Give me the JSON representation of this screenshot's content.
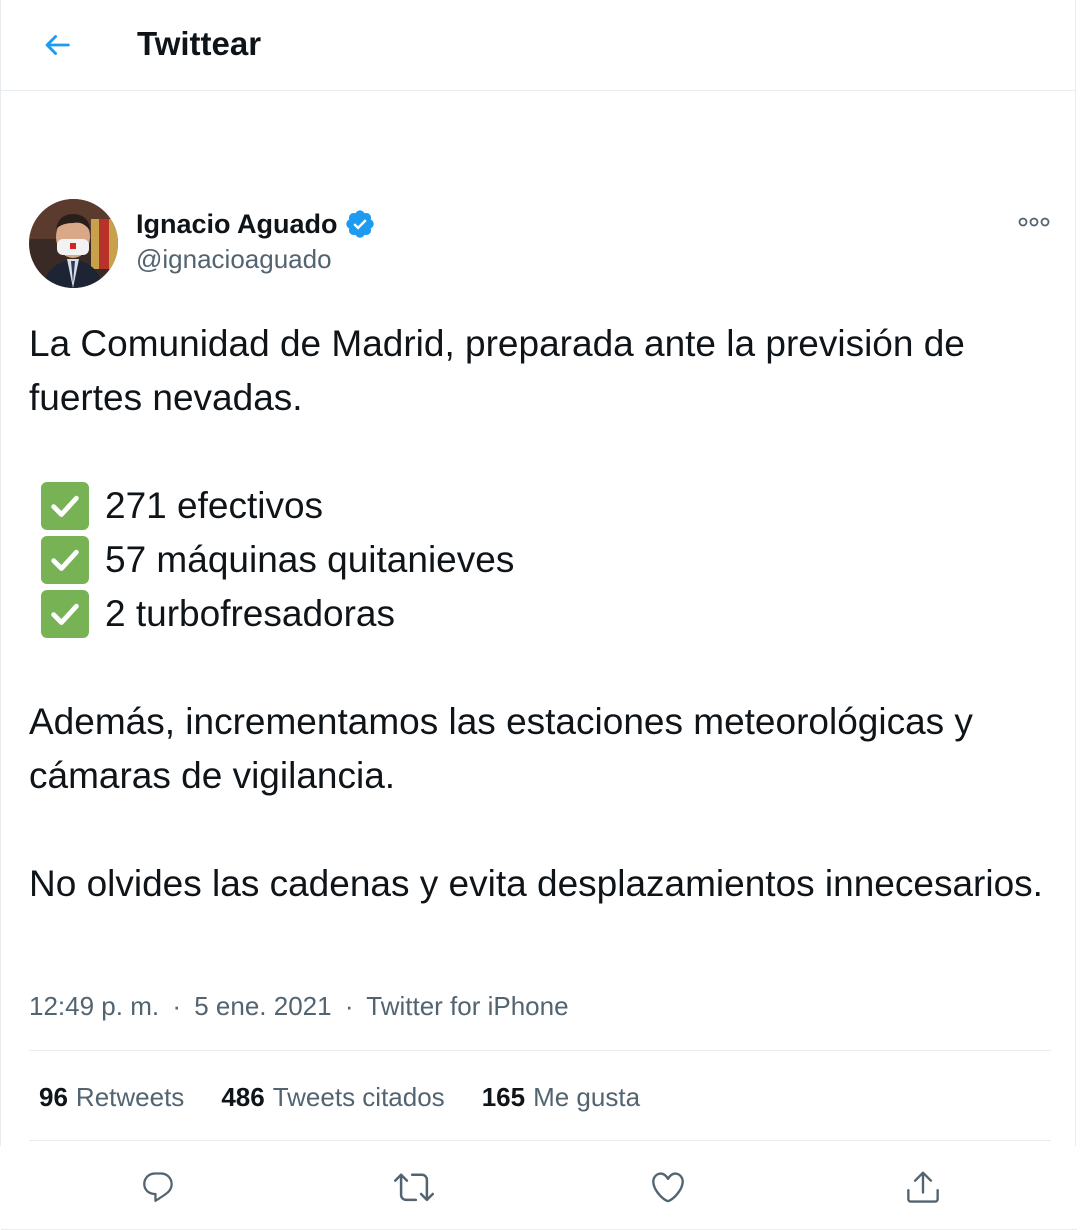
{
  "header": {
    "title": "Twittear",
    "back_icon": "arrow-left-icon"
  },
  "author": {
    "name": "Ignacio Aguado",
    "handle": "@ignacioaguado",
    "verified": true
  },
  "tweet": {
    "paragraph1": "La Comunidad de Madrid, preparada ante la previsión de fuertes nevadas.",
    "checklist": [
      "271 efectivos",
      "57 máquinas quitanieves",
      "2 turbofresadoras"
    ],
    "paragraph2": "Además, incrementamos las estaciones meteorológicas y cámaras de vigilancia.",
    "paragraph3": "No olvides las cadenas y evita desplazamientos innecesarios."
  },
  "meta": {
    "time": "12:49 p. m.",
    "separator": "·",
    "date": "5 ene. 2021",
    "source": "Twitter for iPhone"
  },
  "stats": {
    "retweets_count": "96",
    "retweets_label": "Retweets",
    "quotes_count": "486",
    "quotes_label": "Tweets citados",
    "likes_count": "165",
    "likes_label": "Me gusta"
  },
  "actions": {
    "reply_icon": "reply-icon",
    "retweet_icon": "retweet-icon",
    "like_icon": "heart-icon",
    "share_icon": "share-icon"
  },
  "colors": {
    "accent": "#1d9bf0",
    "text": "#0f1419",
    "secondary": "#536471",
    "border": "#e6ecf0",
    "check_green": "#77b255"
  }
}
